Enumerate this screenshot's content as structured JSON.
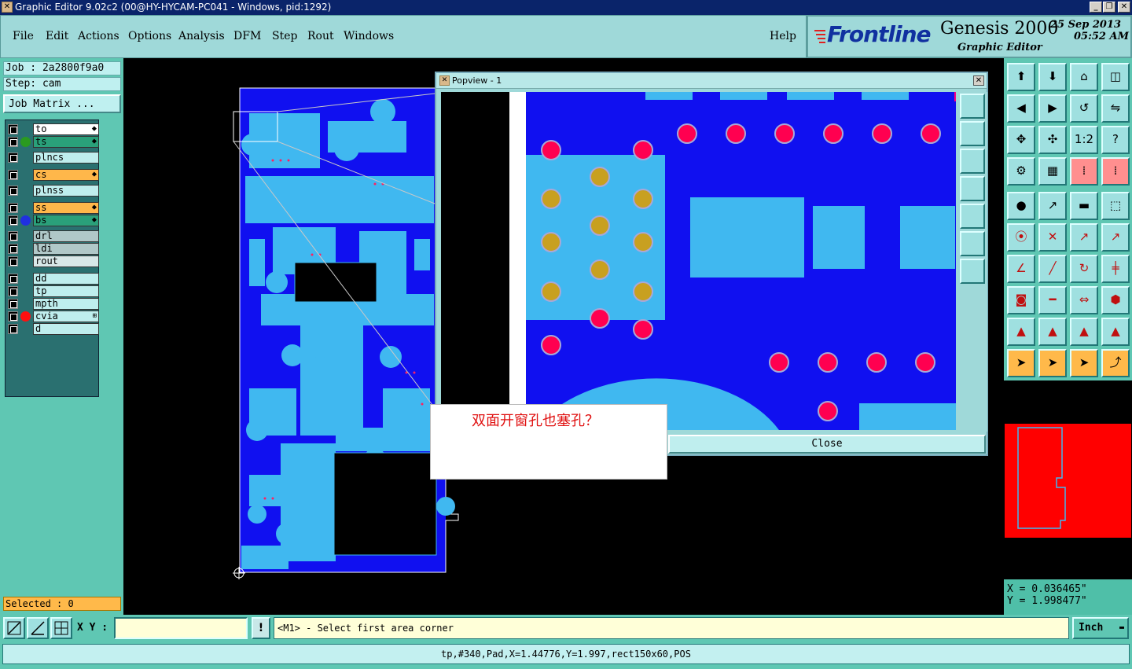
{
  "titlebar": {
    "title": "Graphic Editor 9.02c2 (00@HY-HYCAM-PC041 - Windows, pid:1292)"
  },
  "menu": {
    "items": [
      "File",
      "Edit",
      "Actions",
      "Options",
      "Analysis",
      "DFM",
      "Step",
      "Rout",
      "Windows"
    ],
    "help": "Help"
  },
  "brand": {
    "logo": "Frontline",
    "product": "Genesis 2000",
    "subtitle": "Graphic Editor",
    "date": "25 Sep 2013",
    "time": "05:52 AM"
  },
  "job": {
    "job_label": "Job : 2a2800f9a0",
    "step_label": "Step: cam",
    "matrix_button": "Job Matrix ..."
  },
  "layers": [
    {
      "name": "to",
      "color": "#ffffff",
      "dot": "",
      "mark": "⬥"
    },
    {
      "name": "ts",
      "color": "#2aa07a",
      "dot": "#2a9a20",
      "mark": "⬥"
    },
    {
      "name": "plncs",
      "color": "#bfeeee",
      "dot": "",
      "mark": ""
    },
    {
      "name": "cs",
      "color": "#ffb74a",
      "dot": "",
      "mark": "⬥"
    },
    {
      "name": "plnss",
      "color": "#bfeeee",
      "dot": "",
      "mark": ""
    },
    {
      "name": "ss",
      "color": "#ffb74a",
      "dot": "",
      "mark": "⬥"
    },
    {
      "name": "bs",
      "color": "#2aa07a",
      "dot": "#2030e0",
      "mark": "⬥"
    },
    {
      "name": "drl",
      "color": "#b0c8c8",
      "dot": "",
      "mark": ""
    },
    {
      "name": "ldi",
      "color": "#b0c8c8",
      "dot": "",
      "mark": ""
    },
    {
      "name": "rout",
      "color": "#d8e8e8",
      "dot": "",
      "mark": ""
    },
    {
      "name": "dd",
      "color": "#bfeeee",
      "dot": "",
      "mark": ""
    },
    {
      "name": "tp",
      "color": "#bfeeee",
      "dot": "",
      "mark": ""
    },
    {
      "name": "mpth",
      "color": "#bfeeee",
      "dot": "",
      "mark": ""
    },
    {
      "name": "cvia",
      "color": "#bfeeee",
      "dot": "#ff1010",
      "mark": "⊞"
    },
    {
      "name": "d",
      "color": "#bfeeee",
      "dot": "",
      "mark": ""
    }
  ],
  "selected": "Selected : 0",
  "popview": {
    "title": "Popview - 1",
    "close": "Close"
  },
  "annotation": "双面开窗孔也塞孔？",
  "coords": {
    "x": "X = 0.036465\"",
    "y": "Y = 1.998477\""
  },
  "bottom": {
    "xy_label": "X Y :",
    "xy_value": "",
    "prompt": "<M1> - Select first area corner",
    "unit": "Inch",
    "status": "tp,#340,Pad,X=1.44776,Y=1.997,rect150x60,POS"
  },
  "colors": {
    "board_dark": "#1010f0",
    "board_light": "#40b8f0",
    "via_red": "#ff0050",
    "pad_gold": "#c8a020"
  }
}
